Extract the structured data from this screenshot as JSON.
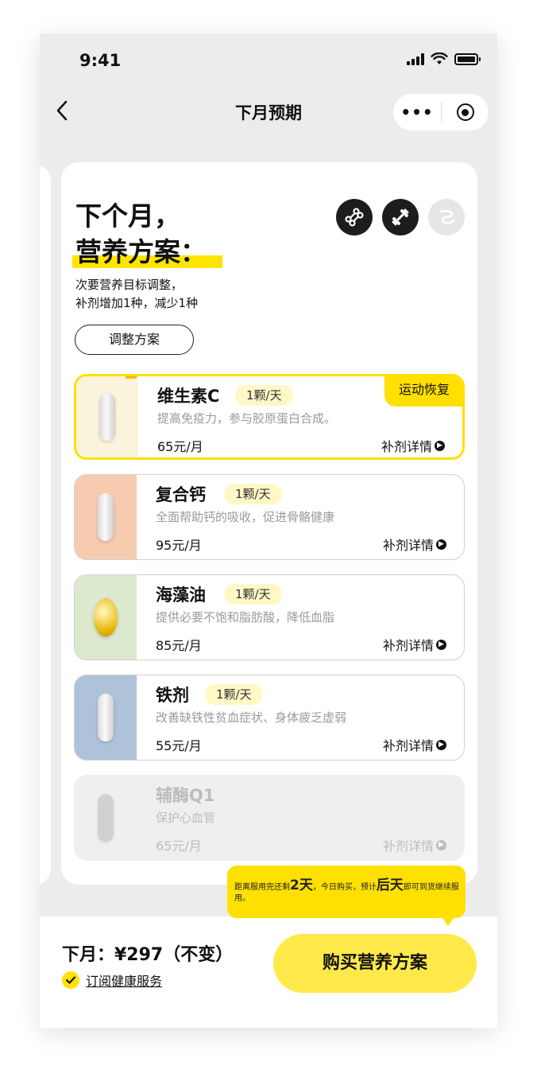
{
  "status_bar": {
    "time": "9:41"
  },
  "nav": {
    "back_icon": "chevron-left-icon",
    "title": "下月预期",
    "more_label": "•••"
  },
  "plan": {
    "headline_line1": "下个月，",
    "headline_line2": "营养方案：",
    "subtitle_line1": "次要营养目标调整，",
    "subtitle_line2": "补剂增加1种，减少1种",
    "adjust_button": "调整方案",
    "goal_icons": [
      "bone-icon",
      "dumbbell-icon",
      "stomach-icon"
    ]
  },
  "supplements": [
    {
      "name": "维生素C",
      "dose": "1颗/天",
      "desc": "提高免疫力，参与胶原蛋白合成。",
      "price": "65元/月",
      "detail": "补剂详情",
      "tag": "运动恢复",
      "thumb_color": "#fbf4dc",
      "pill": "capsule"
    },
    {
      "name": "复合钙",
      "dose": "1颗/天",
      "desc": "全面帮助钙的吸收，促进骨骼健康",
      "price": "95元/月",
      "detail": "补剂详情",
      "thumb_color": "#f6cbb0",
      "pill": "capsule"
    },
    {
      "name": "海藻油",
      "dose": "1颗/天",
      "desc": "提供必要不饱和脂肪酸，降低血脂",
      "price": "85元/月",
      "detail": "补剂详情",
      "thumb_color": "#dde9cf",
      "pill": "softgel"
    },
    {
      "name": "铁剂",
      "dose": "1颗/天",
      "desc": "改善缺铁性贫血症状、身体疲乏虚弱",
      "price": "55元/月",
      "detail": "补剂详情",
      "thumb_color": "#aec2da",
      "pill": "capsule"
    },
    {
      "name": "辅酶Q1",
      "desc": "保护心血管",
      "price": "65元/月",
      "detail": "补剂详情",
      "disabled": true,
      "thumb_color": "#ececec",
      "pill": "capsule"
    }
  ],
  "tooltip": {
    "pre": "距离服用完还剩",
    "days_left": "2天",
    "mid": "，今日购买，预计",
    "arrive": "后天",
    "post": "即可到货继续服用。"
  },
  "footer": {
    "total": "下月：¥297（不变）",
    "subscribe": "订阅健康服务",
    "buy_button": "购买营养方案"
  },
  "colors": {
    "accent": "#ffe000",
    "button": "#ffe94a"
  }
}
